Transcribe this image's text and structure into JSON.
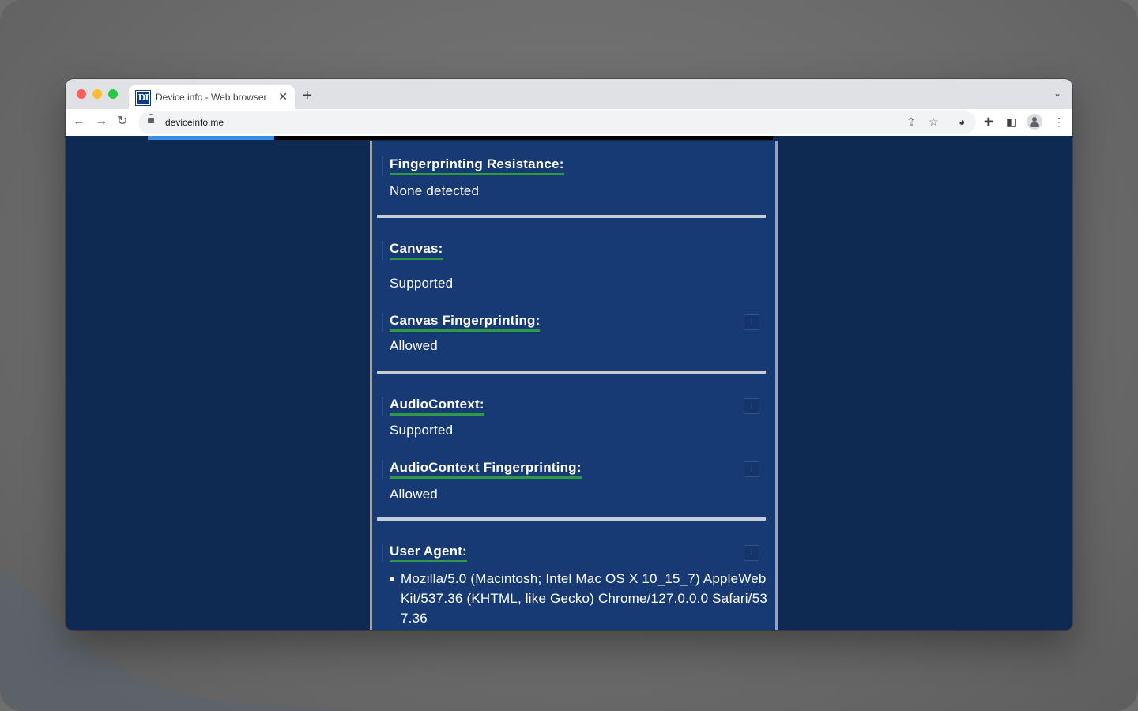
{
  "browser": {
    "tab_title": "Device info - Web browser",
    "favicon_text": "DI",
    "url": "deviceinfo.me",
    "window_controls": {
      "close_color": "#ff5f57",
      "minimize_color": "#febc2e",
      "zoom_color": "#28c840"
    }
  },
  "icons": {
    "back": "arrow-left",
    "forward": "arrow-right",
    "reload": "reload",
    "lock": "lock",
    "share": "share",
    "bookmark": "star",
    "extension_cookie": "cookie",
    "extensions": "puzzle",
    "side_panel": "sidebar",
    "profile": "person",
    "menu": "kebab"
  },
  "page": {
    "sections": {
      "fingerprinting_resistance": {
        "label": "Fingerprinting Resistance:",
        "value": "None detected"
      },
      "canvas": {
        "label": "Canvas:",
        "value": "Supported"
      },
      "canvas_fp": {
        "label": "Canvas Fingerprinting:",
        "value": "Allowed",
        "info": "i"
      },
      "audio": {
        "label": "AudioContext:",
        "value": "Supported",
        "info": "i"
      },
      "audio_fp": {
        "label": "AudioContext Fingerprinting:",
        "value": "Allowed",
        "info": "i"
      },
      "user_agent": {
        "label": "User Agent:",
        "value": "Mozilla/5.0 (Macintosh; Intel Mac OS X 10_15_7) AppleWebKit/537.36 (KHTML, like Gecko) Chrome/127.0.0.0 Safari/537.36",
        "info": "i"
      }
    },
    "colors": {
      "page_bg": "#0e2a52",
      "panel_bg": "#173a75",
      "underline": "#2e9a45",
      "separator": "#c8ccd3",
      "progress": "#3a8ee6"
    }
  }
}
